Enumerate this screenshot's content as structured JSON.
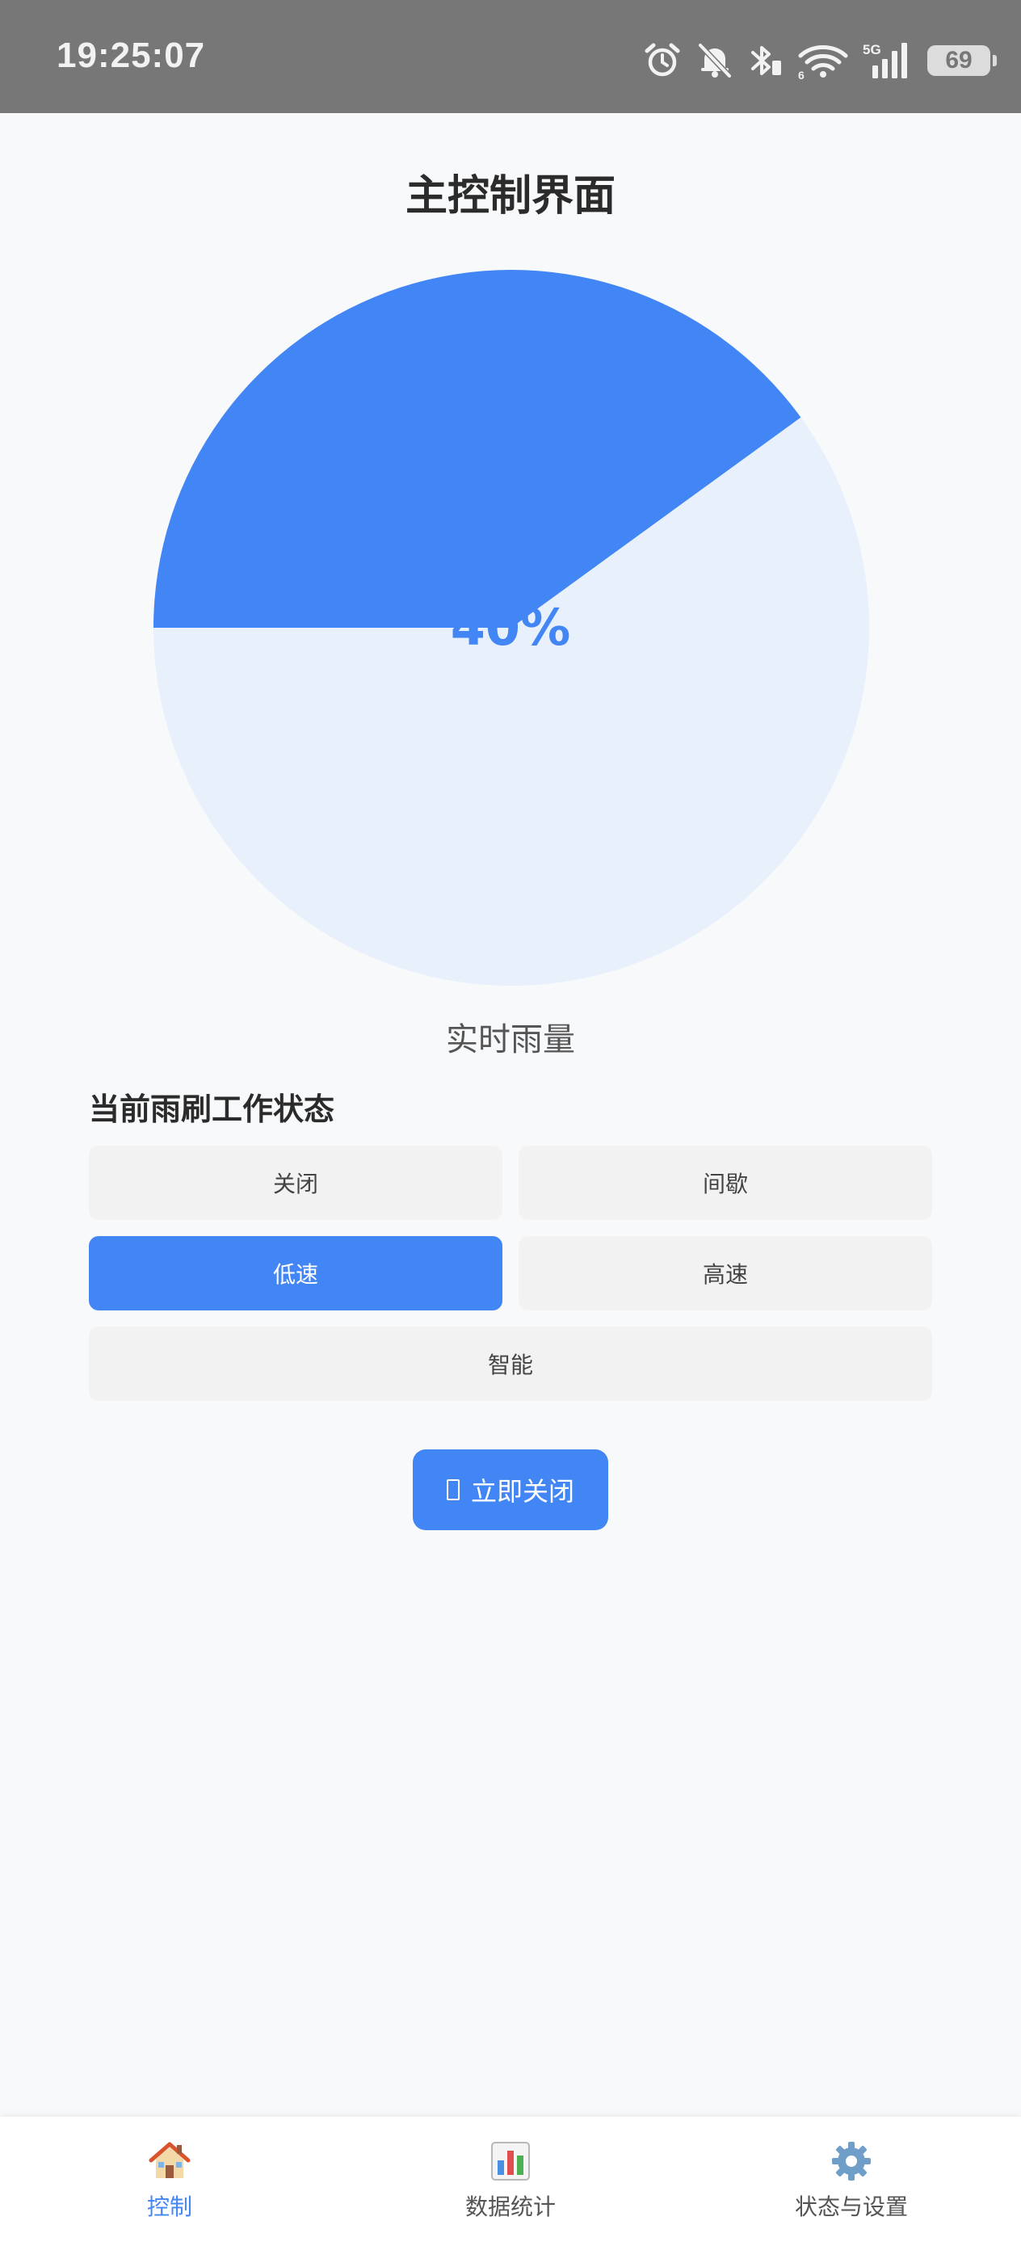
{
  "status_bar": {
    "time": "19:25:07",
    "network": "5G",
    "wifi_badge": "6",
    "battery": "69"
  },
  "page": {
    "title": "主控制界面"
  },
  "gauge": {
    "percent": 40,
    "label": "40%",
    "caption": "实时雨量",
    "fill_color": "#4285f4",
    "track_color": "#e8f0fc"
  },
  "wiper": {
    "section_title": "当前雨刷工作状态",
    "modes": [
      {
        "label": "关闭",
        "active": false
      },
      {
        "label": "间歇",
        "active": false
      },
      {
        "label": "低速",
        "active": true
      },
      {
        "label": "高速",
        "active": false
      },
      {
        "label": "智能",
        "active": false
      }
    ],
    "stop_button": "立即关闭"
  },
  "nav": {
    "items": [
      {
        "label": "控制",
        "icon": "house-icon",
        "active": true
      },
      {
        "label": "数据统计",
        "icon": "bar-chart-icon",
        "active": false
      },
      {
        "label": "状态与设置",
        "icon": "gear-icon",
        "active": false
      }
    ]
  },
  "colors": {
    "accent": "#4285f4",
    "status_bar": "#777777",
    "background": "#f7f9fb"
  }
}
